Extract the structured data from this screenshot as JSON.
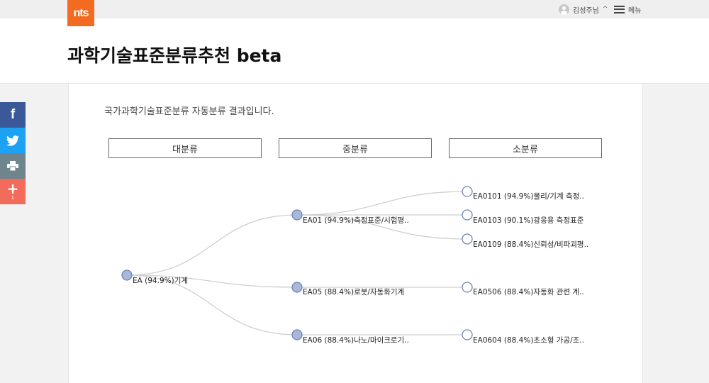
{
  "header": {
    "logo_text": "nts",
    "user_label": "김성주님",
    "user_caret": "^",
    "menu_label": "메뉴"
  },
  "page": {
    "title": "과학기술표준분류추천 beta",
    "intro": "국가과학기술표준분류 자동분류 결과입니다."
  },
  "columns": [
    "대분류",
    "중분류",
    "소분류"
  ],
  "tree": {
    "root": "EA (94.9%)기계",
    "mid": [
      "EA01 (94.9%)측정표준/시험평..",
      "EA05 (88.4%)로봇/자동화기계",
      "EA06 (88.4%)나노/마이크로기.."
    ],
    "leaf": [
      "EA0101 (94.9%)물리/기계 측정..",
      "EA0103 (90.1%)광응용 측정표준",
      "EA0109 (88.4%)신뢰성/비파괴평..",
      "EA0506 (88.4%)자동화 관련 계..",
      "EA0604 (88.4%)초소형 가공/조.."
    ]
  },
  "share": {
    "facebook_icon": "f",
    "plus_icon": "+",
    "plus_count": "1"
  },
  "colors": {
    "brand": "#f26b21",
    "facebook": "#3b5998",
    "twitter": "#1da1f2",
    "print": "#6f858d",
    "plus": "#f26b5b",
    "node_fill": "#a7b8d9",
    "node_stroke": "#6e85b4",
    "link": "#cfcfcf"
  }
}
